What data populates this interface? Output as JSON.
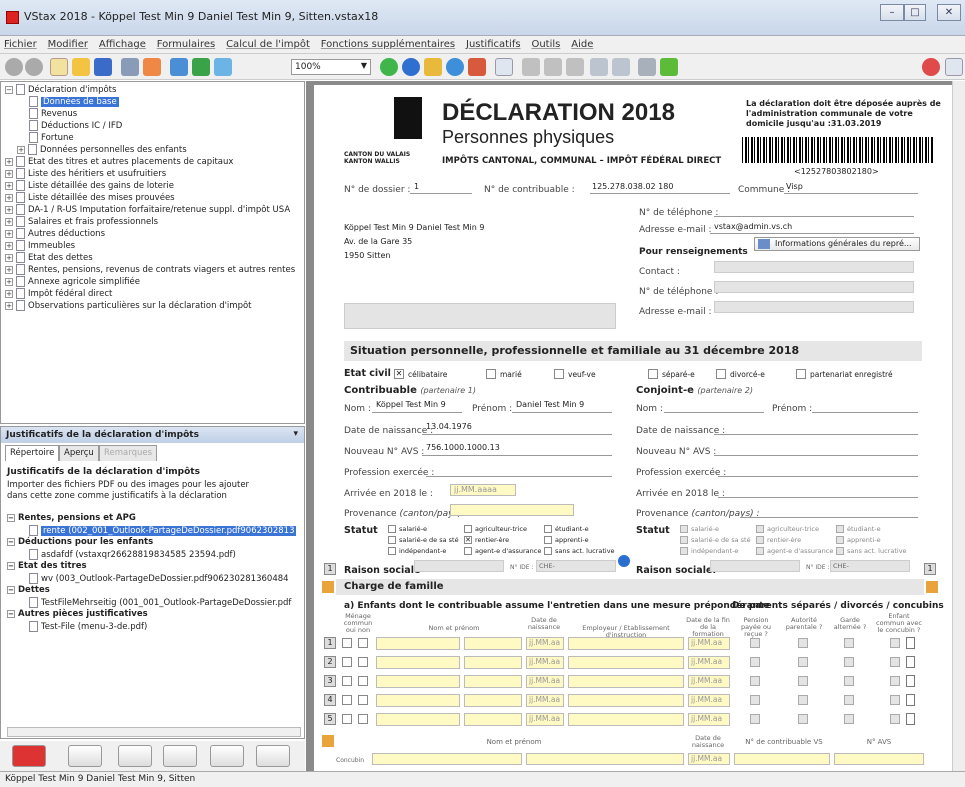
{
  "window": {
    "title": "VStax 2018 - Köppel Test Min 9 Daniel Test Min 9, Sitten.vstax18"
  },
  "menu": [
    "Fichier",
    "Modifier",
    "Affichage",
    "Formulaires",
    "Calcul de l'impôt",
    "Fonctions supplémentaires",
    "Justificatifs",
    "Outils",
    "Aide"
  ],
  "toolbar": {
    "zoom": "100%"
  },
  "tree": [
    {
      "label": "Déclaration d'impôts",
      "level": 0,
      "pm": "−"
    },
    {
      "label": "Données de base",
      "level": 1,
      "selected": true
    },
    {
      "label": "Revenus",
      "level": 1
    },
    {
      "label": "Déductions IC / IFD",
      "level": 1
    },
    {
      "label": "Fortune",
      "level": 1
    },
    {
      "label": "Données personnelles des enfants",
      "level": 1,
      "pm": "+"
    },
    {
      "label": "Etat des titres et autres placements de capitaux",
      "level": 0,
      "pm": "+"
    },
    {
      "label": "Liste des héritiers et usufruitiers",
      "level": 0,
      "pm": "+"
    },
    {
      "label": "Liste détaillée des gains de loterie",
      "level": 0,
      "pm": "+"
    },
    {
      "label": "Liste détaillée des mises prouvées",
      "level": 0,
      "pm": "+"
    },
    {
      "label": "DA-1 / R-US Imputation forfaitaire/retenue suppl. d'impôt USA",
      "level": 0,
      "pm": "+"
    },
    {
      "label": "Salaires et frais professionnels",
      "level": 0,
      "pm": "+"
    },
    {
      "label": "Autres déductions",
      "level": 0,
      "pm": "+"
    },
    {
      "label": "Immeubles",
      "level": 0,
      "pm": "+"
    },
    {
      "label": "Etat des dettes",
      "level": 0,
      "pm": "+"
    },
    {
      "label": "Rentes, pensions, revenus de contrats viagers et autres rentes",
      "level": 0,
      "pm": "+"
    },
    {
      "label": "Annexe agricole simplifiée",
      "level": 0,
      "pm": "+"
    },
    {
      "label": "Impôt fédéral direct",
      "level": 0,
      "pm": "+"
    },
    {
      "label": "Observations particulières sur la déclaration d'impôt",
      "level": 0,
      "pm": "+"
    }
  ],
  "justif": {
    "header": "Justificatifs de la déclaration d'impôts",
    "tabs": [
      "Répertoire",
      "Aperçu",
      "Remarques"
    ],
    "title": "Justificatifs de la déclaration d'impôts",
    "text": "Importer des fichiers PDF ou des images pour les ajouter dans cette zone comme justificatifs à la déclaration",
    "items": [
      {
        "label": "Rentes, pensions et APG",
        "group": true
      },
      {
        "label": "rente (002_001_Outlook-PartageDeDossier.pdf9062302813",
        "selected": true
      },
      {
        "label": "Déductions pour les enfants",
        "group": true
      },
      {
        "label": "asdafdf (vstaxqr26628819834585 23594.pdf)"
      },
      {
        "label": "Etat des titres",
        "group": true
      },
      {
        "label": "wv (003_Outlook-PartageDeDossier.pdf906230281360484",
        "sub": true
      },
      {
        "label": "Dettes",
        "group": true
      },
      {
        "label": "TestFileMehrseitig (001_001_Outlook-PartageDeDossier.pdf"
      },
      {
        "label": "Autres pièces justificatives",
        "group": true
      },
      {
        "label": "Test-File (menu-3-de.pdf)"
      }
    ]
  },
  "status": "Köppel Test Min 9 Daniel Test Min 9, Sitten",
  "form": {
    "canton": "CANTON DU VALAIS\nKANTON WALLIS",
    "title1": "DÉCLARATION 2018",
    "title2": "Personnes physiques",
    "subtitle": "IMPÔTS CANTONAL, COMMUNAL – IMPÔT FÉDÉRAL DIRECT",
    "notice": "La déclaration doit être déposée auprès de l'administration communale de votre domicile jusqu'au :31.03.2019",
    "barcode_num": "<12527803802180>",
    "dossier_lbl": "N° de dossier :",
    "dossier": "1",
    "contrib_lbl": "N° de contribuable :",
    "contrib": "125.278.038.02 180",
    "commune_lbl": "Commune :",
    "commune": "Visp",
    "addr1": "Köppel Test Min 9 Daniel Test Min 9",
    "addr2": "Av. de la Gare 35",
    "addr3": "1950 Sitten",
    "tel_lbl": "N° de téléphone :",
    "email_lbl": "Adresse e-mail :",
    "email": "vstax@admin.vs.ch",
    "info_btn": "Informations générales du repré...",
    "renseign": "Pour renseignements",
    "contact_lbl": "Contact :",
    "tel2_lbl": "N° de téléphone :",
    "email2_lbl": "Adresse e-mail :",
    "situation": "Situation personnelle, professionnelle et familiale au 31 décembre 2018",
    "etat_civil": "Etat civil",
    "ec_options": [
      "célibataire",
      "marié",
      "veuf-ve",
      "séparé-e",
      "divorcé-e",
      "partenariat enregistré"
    ],
    "contrib_head": "Contribuable",
    "contrib_sub": "(partenaire 1)",
    "conj_head": "Conjoint-e",
    "conj_sub": "(partenaire 2)",
    "nom_lbl": "Nom :",
    "nom": "Köppel Test Min 9",
    "prenom_lbl": "Prénom :",
    "prenom": "Daniel Test Min 9",
    "naiss_lbl": "Date de naissance :",
    "naiss": "13.04.1976",
    "avs_lbl": "Nouveau N° AVS :",
    "avs": "756.1000.1000.13",
    "prof_lbl": "Profession exercée :",
    "arrivee_lbl": "Arrivée en 2018 le :",
    "arrivee_ph": "jj.MM.aaaa",
    "prov_lbl": "Provenance",
    "prov_sub": "(canton/pays) :",
    "statut": "Statut",
    "statut_opts": [
      "salarié-e",
      "agriculteur-trice",
      "étudiant-e",
      "salarié-e de sa sté",
      "rentier-ère",
      "apprenti-e",
      "indépendant-e",
      "agent-e d'assurance",
      "sans act. lucrative"
    ],
    "raison": "Raison sociale",
    "raison2": "Raison sociale:",
    "ide": "N° IDE :",
    "che": "CHE-",
    "charge": "Charge de famille",
    "enfants_title": "a) Enfants dont le contribuable assume l'entretien dans une mesure prépondérante",
    "parents_title": "De parents séparés / divorcés / concubins",
    "col_menage": "Ménage commun oui non",
    "col_nom": "Nom et prénom",
    "col_naiss": "Date de naissance",
    "col_employeur": "Employeur / Etablissement d'instruction",
    "col_fin": "Date de la fin de la formation",
    "col_pension": "Pension payée ou reçue ?",
    "col_autorite": "Autorité parentale ?",
    "col_garde": "Garde alternée ?",
    "col_commun": "Enfant commun avec le concubin ?",
    "date_ph": "jj.MM.aa",
    "rows": [
      "1",
      "2",
      "3",
      "4",
      "5"
    ],
    "col_nom2": "Nom et prénom",
    "col_naiss2": "Date de naissance",
    "col_contrib_vs": "N° de contribuable VS",
    "col_avs": "N° AVS",
    "concubin": "Concubin",
    "concubin_date": "jj.MM.aa"
  }
}
